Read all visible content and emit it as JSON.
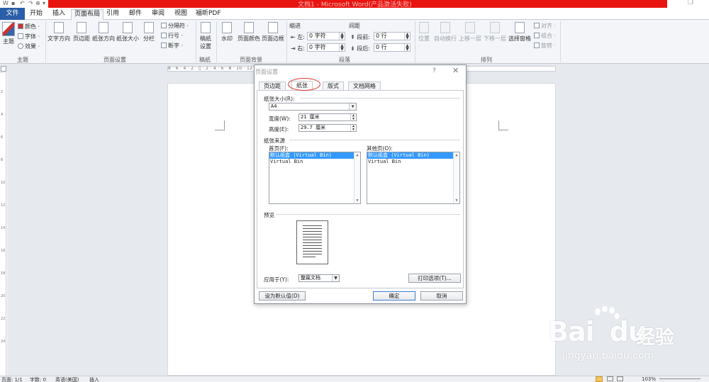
{
  "app": {
    "title": "文档1 - Microsoft Word(产品激活失败)",
    "restore_glyph": "❐"
  },
  "quick_access": [
    "↶",
    "·",
    "↷",
    "·",
    "⊕",
    "▾"
  ],
  "tabs": [
    "文件",
    "开始",
    "插入",
    "页面布局",
    "引用",
    "邮件",
    "审阅",
    "视图",
    "福昕PDF"
  ],
  "ribbon": {
    "theme": {
      "main": "主题",
      "colors": "颜色 ·",
      "fonts": "字体 ·",
      "effects": "效果 ·",
      "group": "主题"
    },
    "page_setup": {
      "text_dir": "文字方向",
      "margins": "页边距",
      "orientation": "纸张方向",
      "size": "纸张大小",
      "columns": "分栏",
      "breaks": "分隔符 ·",
      "line_numbers": "行号 ·",
      "hyphenation": "断字 ·",
      "group": "页面设置"
    },
    "draft": {
      "paper_setup_1": "稿纸",
      "paper_setup_2": "设置",
      "group": "稿纸"
    },
    "background": {
      "watermark": "水印",
      "page_color": "页面颜色",
      "page_borders": "页面边框",
      "group": "页面背景"
    },
    "paragraph": {
      "indent": "缩进",
      "left": "左:",
      "right": "右:",
      "left_val": "0 字符",
      "right_val": "0 字符",
      "spacing": "间距",
      "before": "段前:",
      "after": "段后:",
      "before_val": "0 行",
      "after_val": "0 行",
      "group": "段落"
    },
    "arrange": {
      "position": "位置",
      "wrap": "自动换行",
      "forward": "上移一层",
      "backward": "下移一层",
      "selection_pane": "选择窗格",
      "align": "对齐 ·",
      "group_btn": "组合 ·",
      "rotate": "旋转 ·",
      "group": "排列"
    }
  },
  "ruler": {
    "h_text": "8 · 6 · 4 · 2 · ▯ · 2 · 4 · 6 · 8 · 10 · 12 · 14 · 16 · 18 · 20 · 22 · 24 · 26 · 28 · 30 · 32 · 34 · 36 · 38 · 40 · 42 · 44 · 46 · 48",
    "v_ticks": [
      "2",
      "4",
      "6",
      "8",
      "10",
      "12",
      "14",
      "16",
      "18",
      "20",
      "22",
      "24"
    ]
  },
  "dialog": {
    "title": "页面设置",
    "help": "?",
    "close": "✕",
    "tabs": [
      "页边距",
      "纸张",
      "版式",
      "文档网格"
    ],
    "paper_size_label": "纸张大小(R):",
    "paper_size_value": "A4",
    "width_label": "宽度(W):",
    "width_value": "21 厘米",
    "height_label": "高度(E):",
    "height_value": "29.7 厘米",
    "paper_source_label": "纸张来源",
    "first_page_label": "首页(F):",
    "other_pages_label": "其他页(O):",
    "first_page_items": [
      "默认纸盒 (Virtual Bin)",
      "Virtual Bin"
    ],
    "other_pages_items": [
      "默认纸盒 (Virtual Bin)",
      "Virtual Bin"
    ],
    "preview_label": "预览",
    "apply_label": "应用于(Y):",
    "apply_value": "整篇文档",
    "print_options": "打印选项(T)...",
    "set_default": "设为默认值(D)",
    "ok": "确定",
    "cancel": "取消"
  },
  "statusbar": {
    "page": "页面: 1/1",
    "words": "字数: 0",
    "language": "英语(美国)",
    "mode": "插入",
    "zoom": "103%"
  },
  "watermark": {
    "brand": "Bai",
    "brand_tail": "du",
    "cn": "经验",
    "url": "jingyan.baidu.com"
  },
  "colors": {
    "title_red": "#e8140f",
    "file_tab": "#2a5ea8",
    "selection": "#3399ff",
    "highlight_circle": "#d83a2a"
  }
}
